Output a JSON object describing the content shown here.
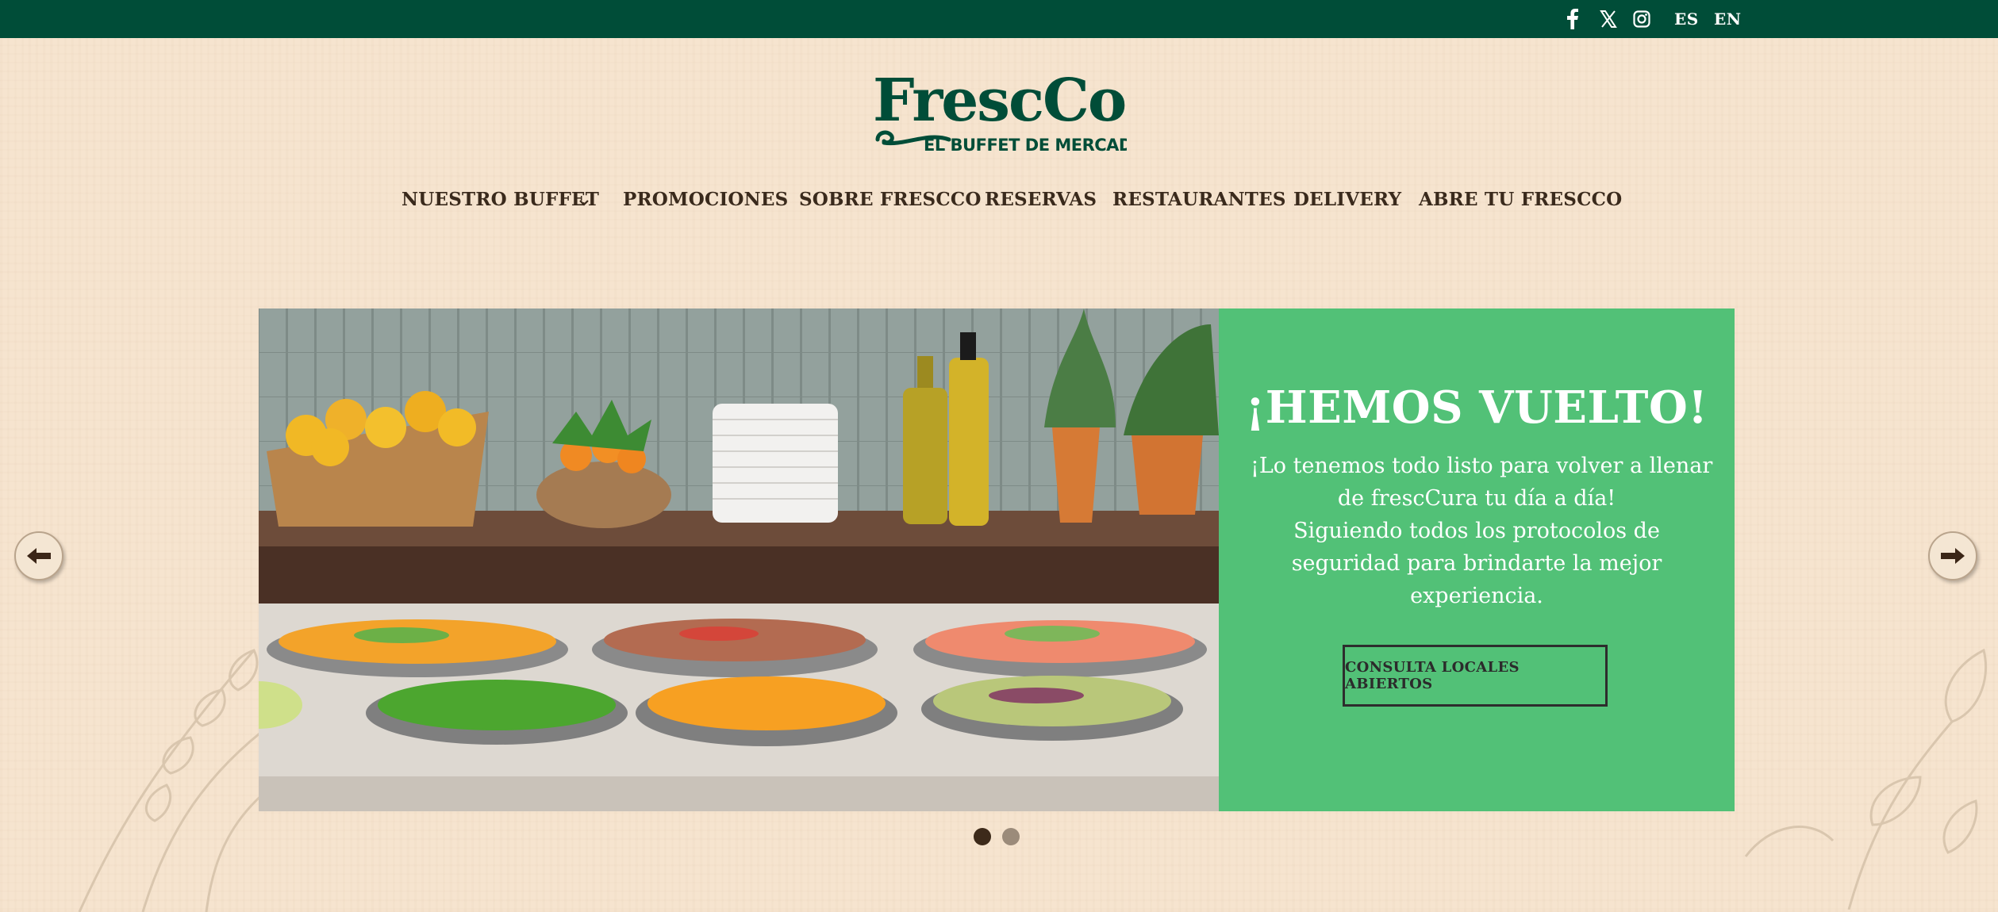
{
  "topbar": {
    "social": [
      {
        "name": "facebook-icon"
      },
      {
        "name": "x-twitter-icon"
      },
      {
        "name": "instagram-icon"
      }
    ],
    "languages": [
      "ES",
      "EN"
    ]
  },
  "logo": {
    "name": "FrescCo",
    "tagline": "EL BUFFET DE MERCADO"
  },
  "nav": {
    "items": [
      {
        "label": "NUESTRO BUFFET"
      },
      {
        "label": "PROMOCIONES"
      },
      {
        "label": "SOBRE FRESCCO"
      },
      {
        "label": "RESERVAS"
      },
      {
        "label": "RESTAURANTES"
      },
      {
        "label": "DELIVERY"
      },
      {
        "label": "ABRE TU FRESCCO"
      }
    ]
  },
  "hero": {
    "title": "¡HEMOS VUELTO!",
    "lines": [
      "¡Lo tenemos todo listo para volver a llenar",
      "de frescCura tu día a día!",
      "Siguiendo todos los protocolos de",
      "seguridad para brindarte la mejor",
      "experiencia."
    ],
    "button": "CONSULTA LOCALES ABIERTOS"
  },
  "slider": {
    "total_slides": 2,
    "active_slide": 1
  },
  "colors": {
    "topbar": "#004d38",
    "page_background": "#f6e4cf",
    "hero_panel": "#52c177",
    "nav_text": "#3a2a1c",
    "logo": "#004d38"
  }
}
